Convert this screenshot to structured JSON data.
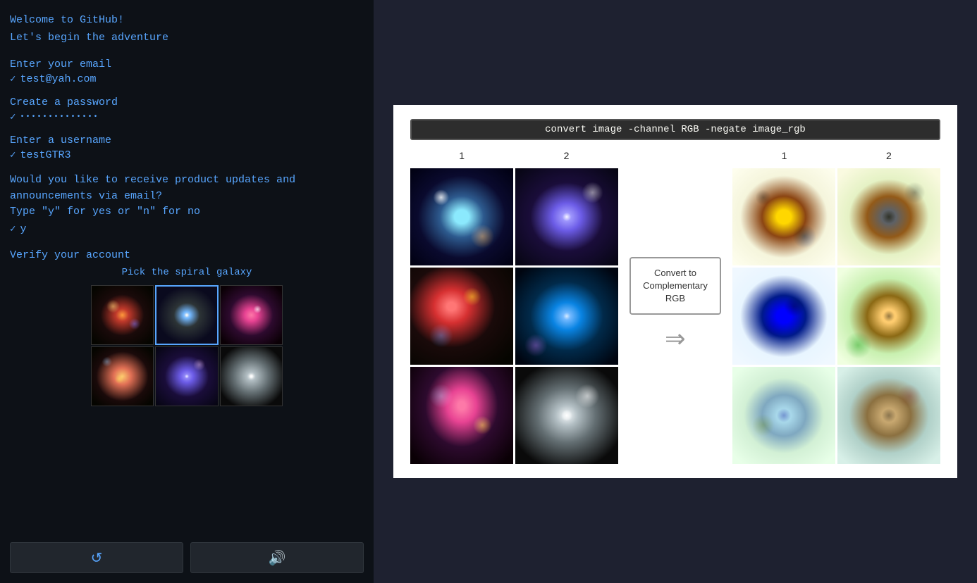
{
  "left": {
    "welcome_title": "Welcome to GitHub!",
    "welcome_sub": "Let's begin the adventure",
    "email_label": "Enter your email",
    "email_value": "test@yah.com",
    "password_label": "Create a password",
    "password_value": "••••••••••••••",
    "username_label": "Enter a username",
    "username_value": "testGTR3",
    "updates_label_1": "Would you like to receive product updates and",
    "updates_label_2": "announcements via email?",
    "updates_label_3": "Type \"y\" for yes or \"n\" for no",
    "updates_value": "y",
    "verify_label": "Verify your account",
    "pick_instruction": "Pick the spiral galaxy",
    "refresh_icon": "↺",
    "audio_icon": "🔊"
  },
  "right": {
    "command": "convert image -channel RGB -negate image_rgb",
    "col1_label": "1",
    "col2_label": "2",
    "out_col1_label": "1",
    "out_col2_label": "2",
    "arrow_label": "Convert to Complementary RGB"
  }
}
